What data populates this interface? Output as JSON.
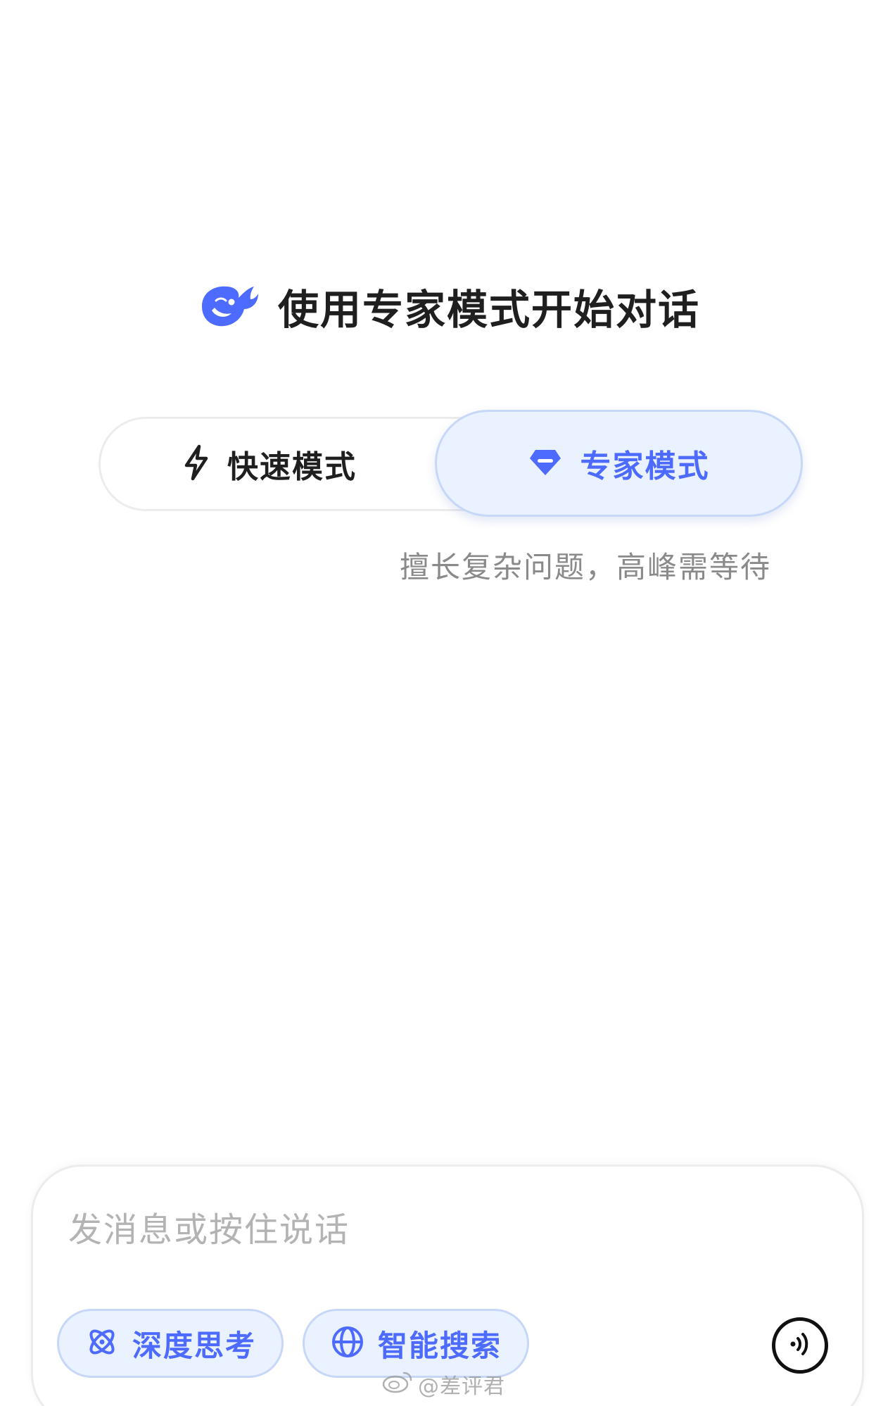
{
  "header": {
    "title": "使用专家模式开始对话",
    "logo_icon": "whale-logo-icon"
  },
  "mode_toggle": {
    "fast": {
      "label": "快速模式",
      "icon": "lightning-icon"
    },
    "expert": {
      "label": "专家模式",
      "icon": "diamond-icon",
      "selected": true
    },
    "description": "擅长复杂问题，高峰需等待"
  },
  "input": {
    "placeholder": "发消息或按住说话",
    "value": ""
  },
  "chips": [
    {
      "label": "深度思考",
      "icon": "atom-icon"
    },
    {
      "label": "智能搜索",
      "icon": "globe-icon"
    }
  ],
  "voice_button": {
    "icon": "voice-wave-icon"
  },
  "watermark": {
    "text": "@差评君"
  },
  "colors": {
    "accent": "#4d6bfe",
    "chip_bg": "#eaf1ff",
    "chip_border": "#c6d7f7",
    "text_primary": "#1f1f1f",
    "text_secondary": "#8a8a8a",
    "placeholder": "#b3b3b3"
  }
}
